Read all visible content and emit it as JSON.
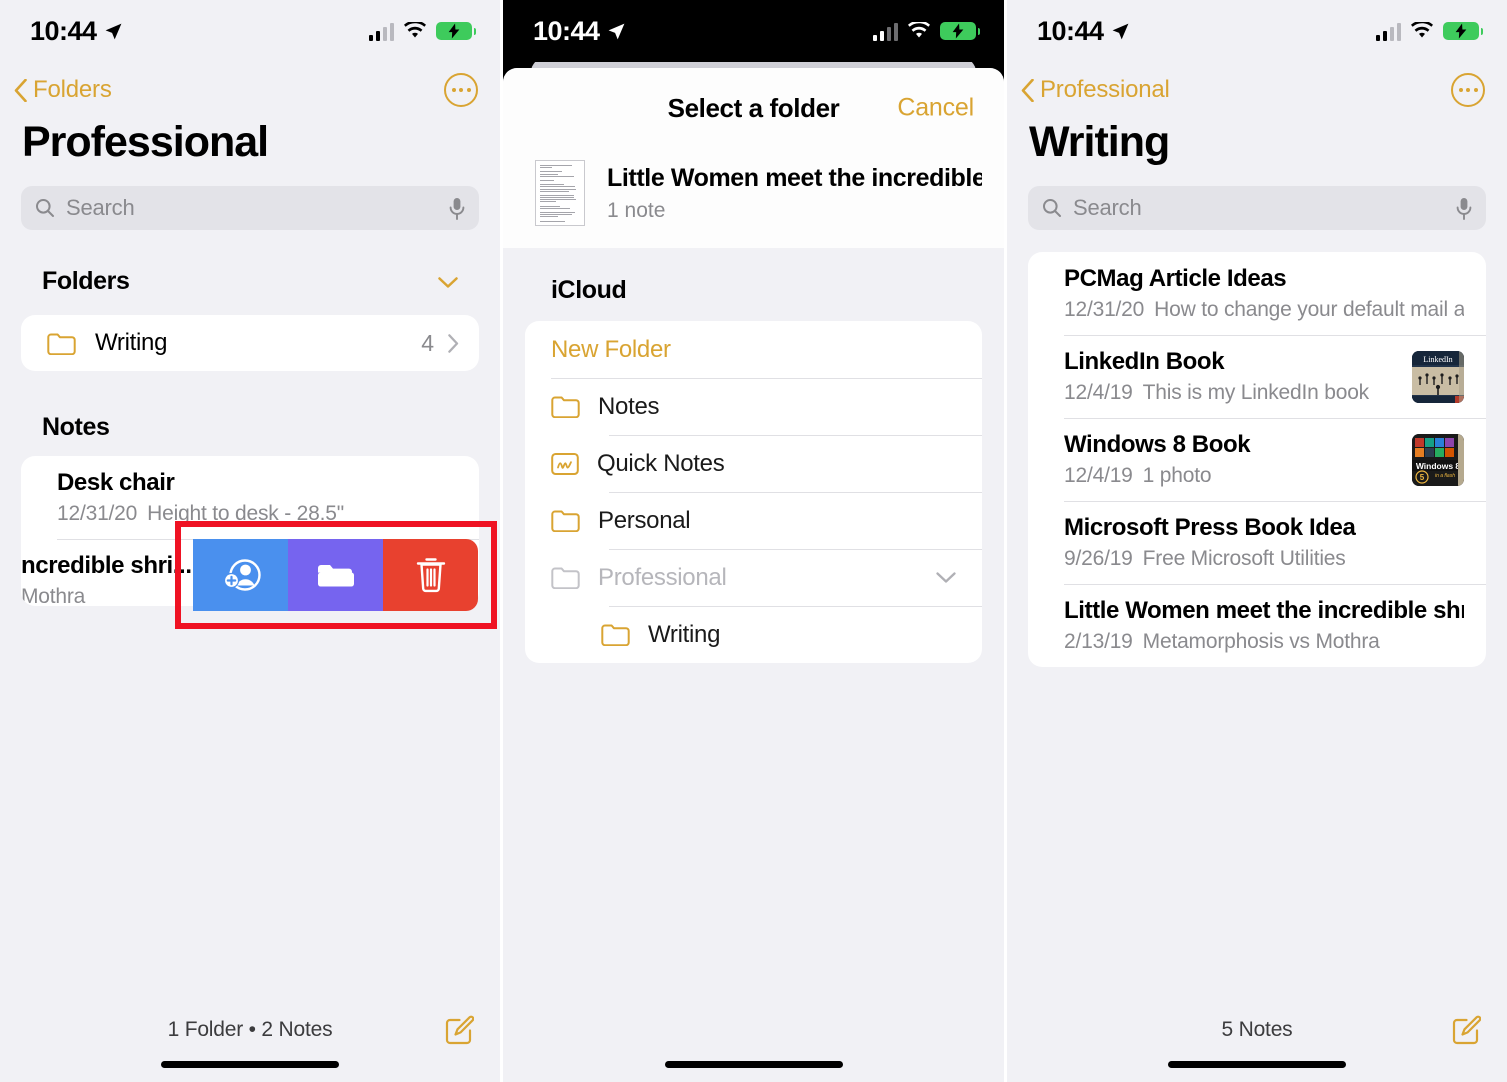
{
  "status": {
    "time": "10:44",
    "location_icon": "location-arrow-icon",
    "signal_icon": "cellular-bars-icon",
    "wifi_icon": "wifi-icon",
    "battery_icon": "battery-charging-icon"
  },
  "panel1": {
    "back_label": "Folders",
    "more_icon": "more-ellipsis-icon",
    "title": "Professional",
    "search": {
      "placeholder": "Search",
      "search_icon": "search-icon",
      "mic_icon": "microphone-icon"
    },
    "folders_header": "Folders",
    "folders_chevron_icon": "chevron-down-icon",
    "folders": [
      {
        "icon": "folder-icon",
        "label": "Writing",
        "count": "4",
        "chevron": "chevron-right-icon"
      }
    ],
    "notes_header": "Notes",
    "notes": [
      {
        "title": "Desk chair",
        "date": "12/31/20",
        "preview": "Height to desk - 28.5\""
      },
      {
        "title": "ncredible shri...",
        "date": "",
        "preview": "Mothra"
      }
    ],
    "swipe_actions": [
      {
        "name": "share-note-action",
        "icon": "person-add-icon",
        "color": "#4a90ee"
      },
      {
        "name": "move-note-action",
        "icon": "folder-solid-icon",
        "color": "#7664ef"
      },
      {
        "name": "delete-note-action",
        "icon": "trash-icon",
        "color": "#e8412f"
      }
    ],
    "highlight_color": "#ef1223",
    "bottom_count": "1 Folder • 2 Notes",
    "compose_icon": "compose-icon"
  },
  "panel2": {
    "sheet_title": "Select a folder",
    "cancel_label": "Cancel",
    "note": {
      "title": "Little Women meet the incredible s...",
      "subtitle": "1 note",
      "thumb_icon": "note-page-thumbnail"
    },
    "account_label": "iCloud",
    "new_folder_label": "New Folder",
    "folders": [
      {
        "label": "Notes",
        "icon": "folder-icon",
        "indent": false,
        "dim": false,
        "chevron": ""
      },
      {
        "label": "Quick Notes",
        "icon": "quick-note-icon",
        "indent": false,
        "dim": false,
        "chevron": ""
      },
      {
        "label": "Personal",
        "icon": "folder-icon",
        "indent": false,
        "dim": false,
        "chevron": ""
      },
      {
        "label": "Professional",
        "icon": "folder-icon",
        "indent": false,
        "dim": true,
        "chevron": "chevron-down-icon"
      },
      {
        "label": "Writing",
        "icon": "folder-icon",
        "indent": true,
        "dim": false,
        "chevron": ""
      }
    ]
  },
  "panel3": {
    "back_label": "Professional",
    "more_icon": "more-ellipsis-icon",
    "title": "Writing",
    "search": {
      "placeholder": "Search",
      "search_icon": "search-icon",
      "mic_icon": "microphone-icon"
    },
    "notes": [
      {
        "title": "PCMag Article Ideas",
        "date": "12/31/20",
        "preview": "How to change your default mail a...",
        "thumb": ""
      },
      {
        "title": "LinkedIn Book",
        "date": "12/4/19",
        "preview": "This is my LinkedIn book",
        "thumb": "linkedin-book-cover"
      },
      {
        "title": "Windows 8 Book",
        "date": "12/4/19",
        "preview": "1 photo",
        "thumb": "windows8-book-cover"
      },
      {
        "title": "Microsoft Press Book Idea",
        "date": "9/26/19",
        "preview": "Free Microsoft Utilities",
        "thumb": ""
      },
      {
        "title": "Little Women meet the incredible shri...",
        "date": "2/13/19",
        "preview": "Metamorphosis vs Mothra",
        "thumb": ""
      }
    ],
    "bottom_count": "5 Notes",
    "compose_icon": "compose-icon"
  },
  "theme": {
    "accent": "#d9a432",
    "bg": "#f1f1f5",
    "card": "#ffffff",
    "secondary_text": "#8a8a8e"
  }
}
